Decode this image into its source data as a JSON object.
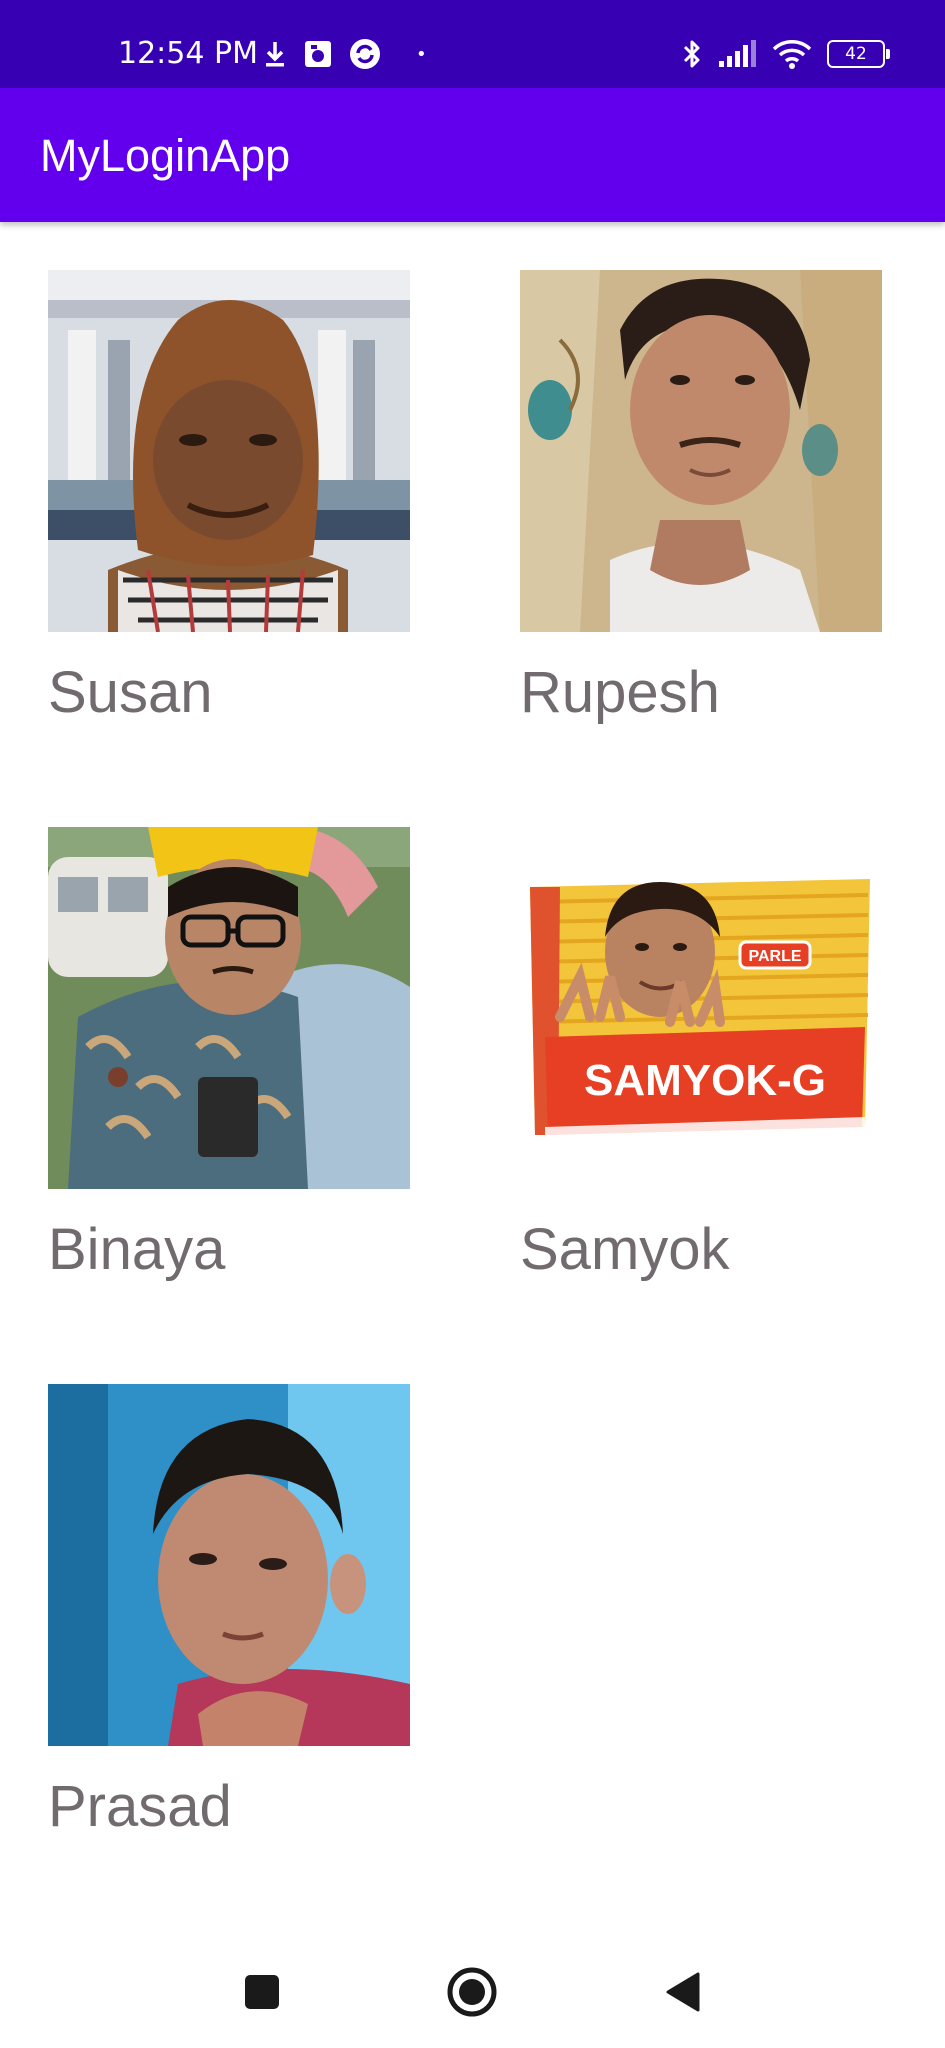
{
  "status_bar": {
    "time": "12:54 PM",
    "dot": "•",
    "left_icons": [
      "download-icon",
      "photo-icon",
      "sync-app-icon"
    ],
    "right_icons": [
      "bluetooth-icon",
      "signal-icon",
      "wifi-icon",
      "battery-icon"
    ],
    "battery_level": "42"
  },
  "app_bar": {
    "title": "MyLoginApp",
    "color": "#6200ee"
  },
  "people": [
    {
      "name": "Susan",
      "photo": "photo of man wearing brown hood and plaid scarf"
    },
    {
      "name": "Rupesh",
      "photo": "photo of young man in white t-shirt"
    },
    {
      "name": "Binaya",
      "photo": "photo of man with glasses and yellow hat"
    },
    {
      "name": "Samyok",
      "photo": "biscuit packet parody image"
    },
    {
      "name": "Prasad",
      "photo": "photo of boy with short hair"
    }
  ],
  "samyok_pack": {
    "brand": "PARLE",
    "product": "SAMYOK-G"
  },
  "nav_bar": {
    "items": [
      "recents-button",
      "home-button",
      "back-button"
    ]
  },
  "colors": {
    "status_bar": "#3700b3",
    "app_bar": "#6200ee",
    "name_text": "#716a6e"
  }
}
